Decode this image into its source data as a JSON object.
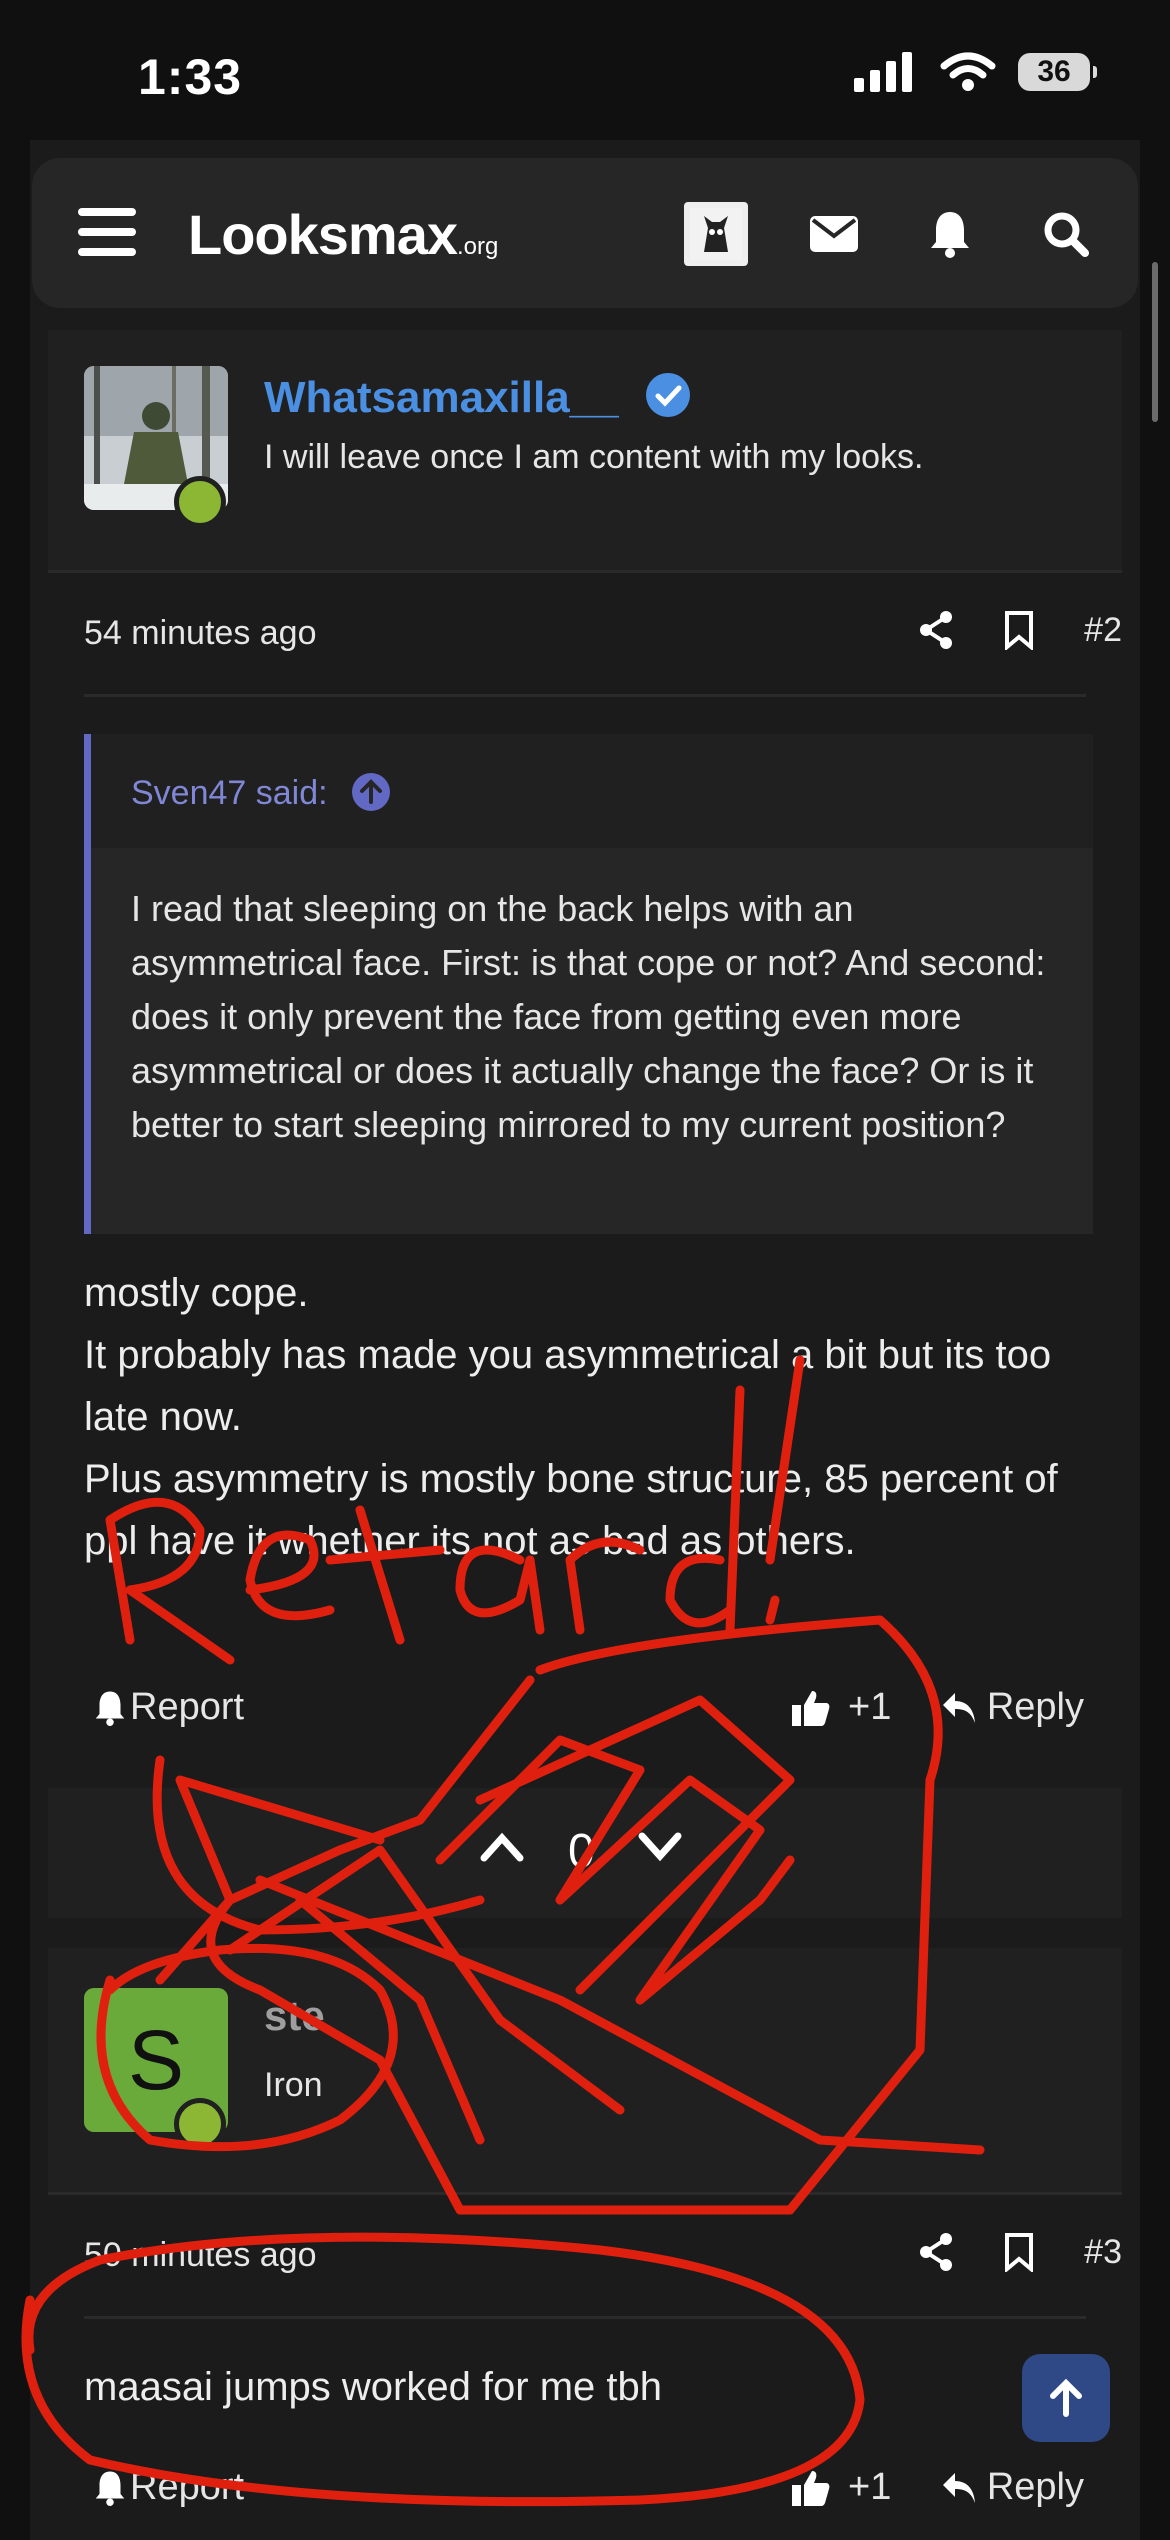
{
  "status_bar": {
    "time": "1:33",
    "battery": "36"
  },
  "header": {
    "logo_main": "Looksmax",
    "logo_suffix": ".org"
  },
  "post2": {
    "username": "Whatsamaxilla__",
    "user_title": "I will leave once I am content with my looks.",
    "time_ago": "54 minutes ago",
    "post_number": "#2",
    "quote_author": "Sven47 said:",
    "quote_text": "I read that sleeping on the back helps with an asymmetrical face. First: is that cope or not? And second: does it only prevent the face from getting even more asymmetrical or does it actually change the face? Or is it better to start sleeping mirrored to my current position?",
    "body_lines": [
      "mostly cope.",
      "It probably has made you asymmetrical a bit but its too late now.",
      "Plus asymmetry is mostly bone structure, 85 percent of ppl have it whether its not as bad as others."
    ],
    "report_label": "Report",
    "like_count": "+1",
    "reply_label": "Reply"
  },
  "voting": {
    "score": "0"
  },
  "post3": {
    "avatar_letter": "S",
    "username": "ste",
    "user_title": "Iron",
    "time_ago": "50 minutes ago",
    "post_number": "#3",
    "body": "maasai jumps worked for me tbh",
    "report_label": "Report",
    "like_count": "+1",
    "reply_label": "Reply"
  },
  "annotation": {
    "text": "Retard!",
    "color": "#e0200f"
  },
  "colors": {
    "accent": "#4a8fe2",
    "quote_border": "#6169c4",
    "online": "#8bb734",
    "scroll_top": "#2f4886"
  }
}
